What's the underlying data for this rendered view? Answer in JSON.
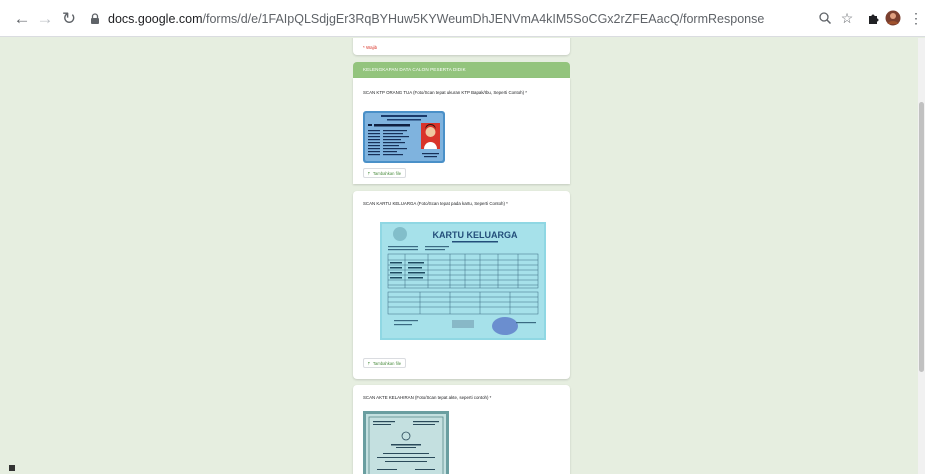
{
  "browser": {
    "url_host": "docs.google.com",
    "url_path": "/forms/d/e/1FAIpQLSdjgEr3RqBYHuw5KYWeumDhJENVmA4kIM5SoCGx2rZFEAacQ/formResponse"
  },
  "form": {
    "required_note": "* Wajib",
    "section_title": "KELENGKAPAN DATA CALON PESERTA DIDIK",
    "questions": [
      {
        "label": "SCAN KTP ORANG TUA (Foto/Scan tepat ukuran KTP Bapak/Ibu, Seperti Contoh) *",
        "upload_label": "Tambahkan file"
      },
      {
        "label": "SCAN KARTU KELUARGA (Foto/Scan tepat pada kartu, Seperti Contoh) *",
        "upload_label": "Tambahkan file",
        "image_heading": "KARTU KELUARGA"
      },
      {
        "label": "SCAN AKTE KELAHIRAN (Foto/Scan tepat akte, seperti contoh) *"
      }
    ]
  },
  "colors": {
    "accent": "#93c47d",
    "background": "#e6eee0",
    "required": "#d93025"
  },
  "icons": [
    "back-icon",
    "forward-icon",
    "reload-icon",
    "lock-icon",
    "zoom-icon",
    "star-icon",
    "extension-icon",
    "profile-avatar",
    "menu-dots-icon",
    "upload-icon"
  ]
}
